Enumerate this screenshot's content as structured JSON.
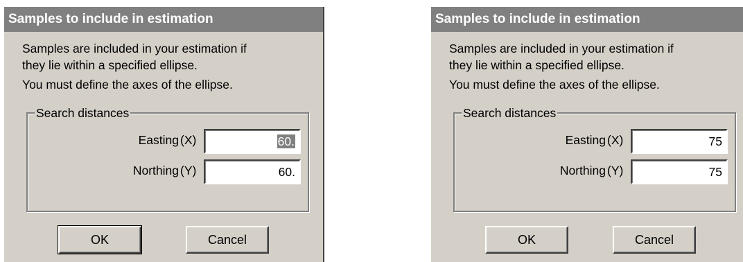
{
  "dialogs": [
    {
      "title": "Samples to include in estimation",
      "description_line1": "Samples are included in your estimation if",
      "description_line2": "they lie within a specified ellipse.",
      "description_line3": "You must define the axes of the ellipse.",
      "group_title": "Search distances",
      "easting_label": "Easting",
      "easting_axis": "(X)",
      "easting_value": "60.",
      "northing_label": "Northing",
      "northing_axis": "(Y)",
      "northing_value": "60.",
      "ok_label": "OK",
      "cancel_label": "Cancel"
    },
    {
      "title": "Samples to include in estimation",
      "description_line1": "Samples are included in your estimation if",
      "description_line2": "they lie within a specified ellipse.",
      "description_line3": "You must define the axes of the ellipse.",
      "group_title": "Search distances",
      "easting_label": "Easting",
      "easting_axis": "(X)",
      "easting_value": "75",
      "northing_label": "Northing",
      "northing_axis": "(Y)",
      "northing_value": "75",
      "ok_label": "OK",
      "cancel_label": "Cancel"
    }
  ]
}
